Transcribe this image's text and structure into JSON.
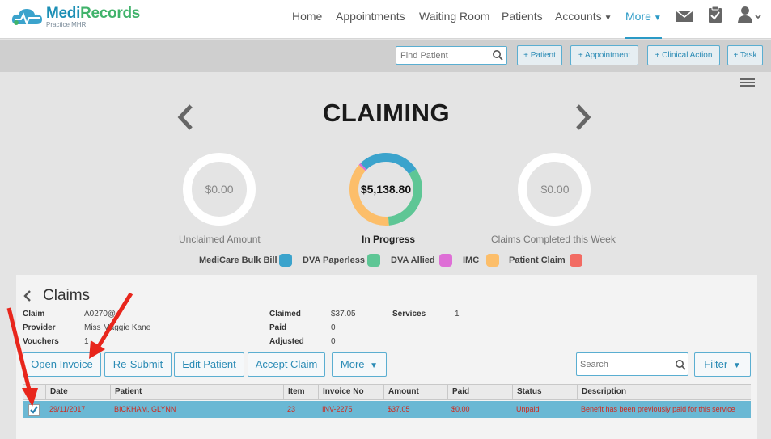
{
  "app": {
    "logo_name": "MediRecords",
    "logo_name_a": "Medi",
    "logo_name_b": "Records",
    "logo_sub": "Practice MHR"
  },
  "nav": {
    "items": [
      {
        "label": "Home"
      },
      {
        "label": "Appointments"
      },
      {
        "label": "Waiting Room"
      },
      {
        "label": "Patients"
      },
      {
        "label": "Accounts"
      },
      {
        "label": "More"
      }
    ]
  },
  "actionbar": {
    "find_placeholder": "Find Patient",
    "buttons": [
      "+ Patient",
      "+ Appointment",
      "+ Clinical Action",
      "+ Task"
    ]
  },
  "page": {
    "title": "CLAIMING"
  },
  "summary": {
    "unclaimed": {
      "value": "$0.00",
      "caption": "Unclaimed Amount"
    },
    "in_progress": {
      "value": "$5,138.80",
      "caption": "In Progress"
    },
    "completed": {
      "value": "$0.00",
      "caption": "Claims Completed this Week"
    }
  },
  "chart_data": {
    "type": "pie",
    "title": "",
    "categories": [
      "MediCare Bulk Bill",
      "DVA Paperless",
      "DVA Allied",
      "IMC",
      "Patient Claim"
    ],
    "values": [
      28,
      33,
      1,
      38,
      0
    ],
    "colors": [
      "#3ba3cc",
      "#5ec695",
      "#de6fd6",
      "#fcbe6a",
      "#f26b63"
    ],
    "legend": "bottom"
  },
  "legend": {
    "items": [
      {
        "label": "MediCare Bulk Bill",
        "color": "#3ba3cc"
      },
      {
        "label": "DVA Paperless",
        "color": "#5ec695"
      },
      {
        "label": "DVA Allied",
        "color": "#de6fd6"
      },
      {
        "label": "IMC",
        "color": "#fcbe6a"
      },
      {
        "label": "Patient Claim",
        "color": "#f26b63"
      }
    ]
  },
  "claims": {
    "title": "Claims",
    "meta": {
      "claim_label": "Claim",
      "claim_value": "A0270@",
      "provider_label": "Provider",
      "provider_value": "Miss Maggie Kane",
      "vouchers_label": "Vouchers",
      "vouchers_value": "1",
      "claimed_label": "Claimed",
      "claimed_value": "$37.05",
      "paid_label": "Paid",
      "paid_value": "0",
      "adjusted_label": "Adjusted",
      "adjusted_value": "0",
      "services_label": "Services",
      "services_value": "1"
    },
    "buttons": {
      "open_invoice": "Open Invoice",
      "resubmit": "Re-Submit",
      "edit_patient": "Edit Patient",
      "accept_claim": "Accept Claim",
      "more": "More",
      "filter": "Filter"
    },
    "search_placeholder": "Search",
    "columns": [
      "Date",
      "Patient",
      "Item",
      "Invoice No",
      "Amount",
      "Paid",
      "Status",
      "Description"
    ],
    "rows": [
      {
        "date": "29/11/2017",
        "patient": "BICKHAM, GLYNN",
        "item": "23",
        "invoice": "INV-2275",
        "amount": "$37.05",
        "paid": "$0.00",
        "status": "Unpaid",
        "description": "Benefit has been previously paid for this service"
      }
    ]
  }
}
